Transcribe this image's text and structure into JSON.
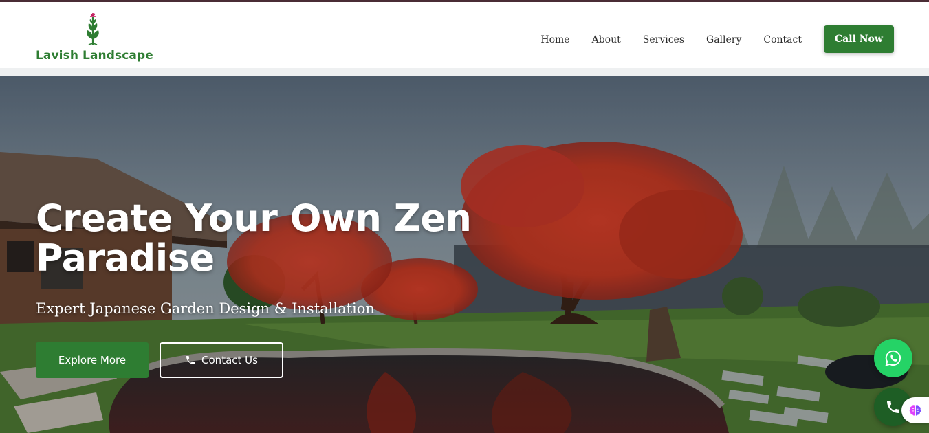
{
  "brand": {
    "name": "Lavish Landscape",
    "logo_icon": "plant-sprout-icon",
    "primary_color": "#2e7d32",
    "top_strip_color": "#4a2c35"
  },
  "nav": {
    "items": [
      {
        "label": "Home"
      },
      {
        "label": "About"
      },
      {
        "label": "Services"
      },
      {
        "label": "Gallery"
      },
      {
        "label": "Contact"
      }
    ],
    "cta_label": "Call Now"
  },
  "hero": {
    "title": "Create Your Own Zen Paradise",
    "subtitle": "Expert Japanese Garden Design & Installation",
    "image": "japanese-garden-red-maple-pond",
    "buttons": {
      "explore_label": "Explore More",
      "contact_label": "Contact Us",
      "contact_icon": "phone-icon"
    }
  },
  "floating_actions": {
    "whatsapp_icon": "whatsapp-icon",
    "whatsapp_color": "#25d366",
    "phone_icon": "phone-icon",
    "phone_color": "#1e5e25",
    "assistant_icon": "brain-icon"
  }
}
